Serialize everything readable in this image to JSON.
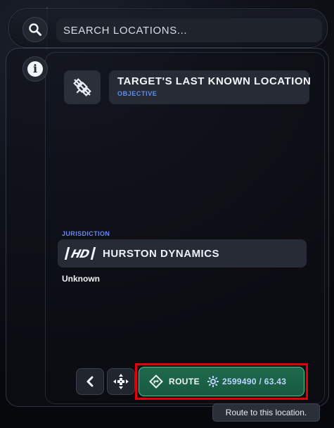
{
  "search": {
    "placeholder": "SEARCH LOCATIONS..."
  },
  "objective": {
    "title": "TARGET'S LAST KNOWN LOCATION",
    "subtitle": "OBJECTIVE",
    "icon": "satellite-icon"
  },
  "jurisdiction": {
    "label": "JURISDICTION",
    "logo_text": "HD",
    "name": "HURSTON DYNAMICS",
    "status": "Unknown"
  },
  "controls": {
    "back_icon": "chevron-left-icon",
    "navigate_icon": "waypoint-icon",
    "route_label": "ROUTE",
    "route_value": "2599490 / 63.43",
    "route_icon": "route-sign-icon",
    "gear_icon": "gear-icon"
  },
  "tooltip": {
    "text": "Route to this location."
  },
  "colors": {
    "accent_blue": "#5e8ff0",
    "route_green": "#1f6a4c",
    "route_border": "#3fd08e",
    "highlight_red": "#e3000b"
  }
}
